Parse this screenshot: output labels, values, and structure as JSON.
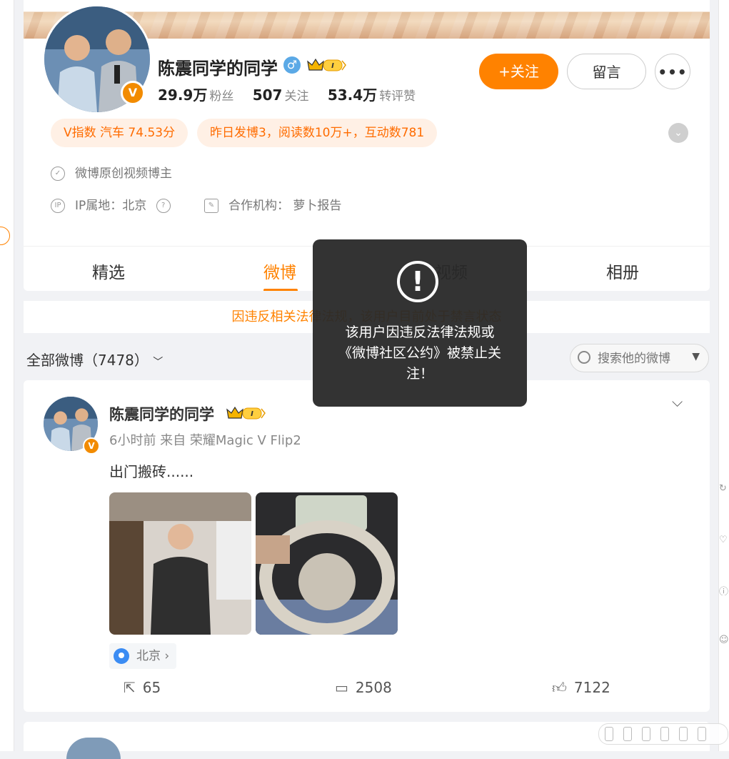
{
  "profile": {
    "name": "陈震同学的同学",
    "gender_symbol": "♂",
    "verified_badge": "V",
    "stats": {
      "fans_value": "29.9万",
      "fans_label": "粉丝",
      "following_value": "507",
      "following_label": "关注",
      "reposts_value": "53.4万",
      "reposts_label": "转评赞"
    },
    "buttons": {
      "follow": "+关注",
      "message": "留言",
      "more": "•••"
    },
    "tags": [
      "V指数 汽车 74.53分",
      "昨日发博3，阅读数10万+，互动数781"
    ],
    "info": {
      "creator": "微博原创视频博主",
      "ip": "IP属地：北京",
      "agency": "合作机构： 萝卜报告"
    }
  },
  "tabs": [
    "精选",
    "微博",
    "视频",
    "相册"
  ],
  "active_tab": "微博",
  "banner": "因违反相关法律法规，该用户目前处于禁言状态",
  "filter": {
    "label": "全部微博（7478）",
    "search_placeholder": "搜索他的微博"
  },
  "post": {
    "author": "陈震同学的同学",
    "meta": "6小时前 来自 荣耀Magic V Flip2",
    "text": "出门搬砖......",
    "location": "北京",
    "actions": {
      "reposts": "65",
      "comments": "2508",
      "likes": "7122"
    }
  },
  "modal": {
    "message": "该用户因违反法律法规或《微博社区公约》被禁止关注！"
  },
  "colors": {
    "accent": "#ff8200",
    "verify": "#f28b00",
    "gender": "#5ba9e6",
    "location_pin": "#3b8cf3"
  },
  "icons": [
    "shield-icon",
    "ip-icon",
    "help-icon",
    "agency-icon",
    "search-icon",
    "repost-icon",
    "comment-icon",
    "like-icon",
    "warning-icon",
    "location-pin-icon"
  ]
}
